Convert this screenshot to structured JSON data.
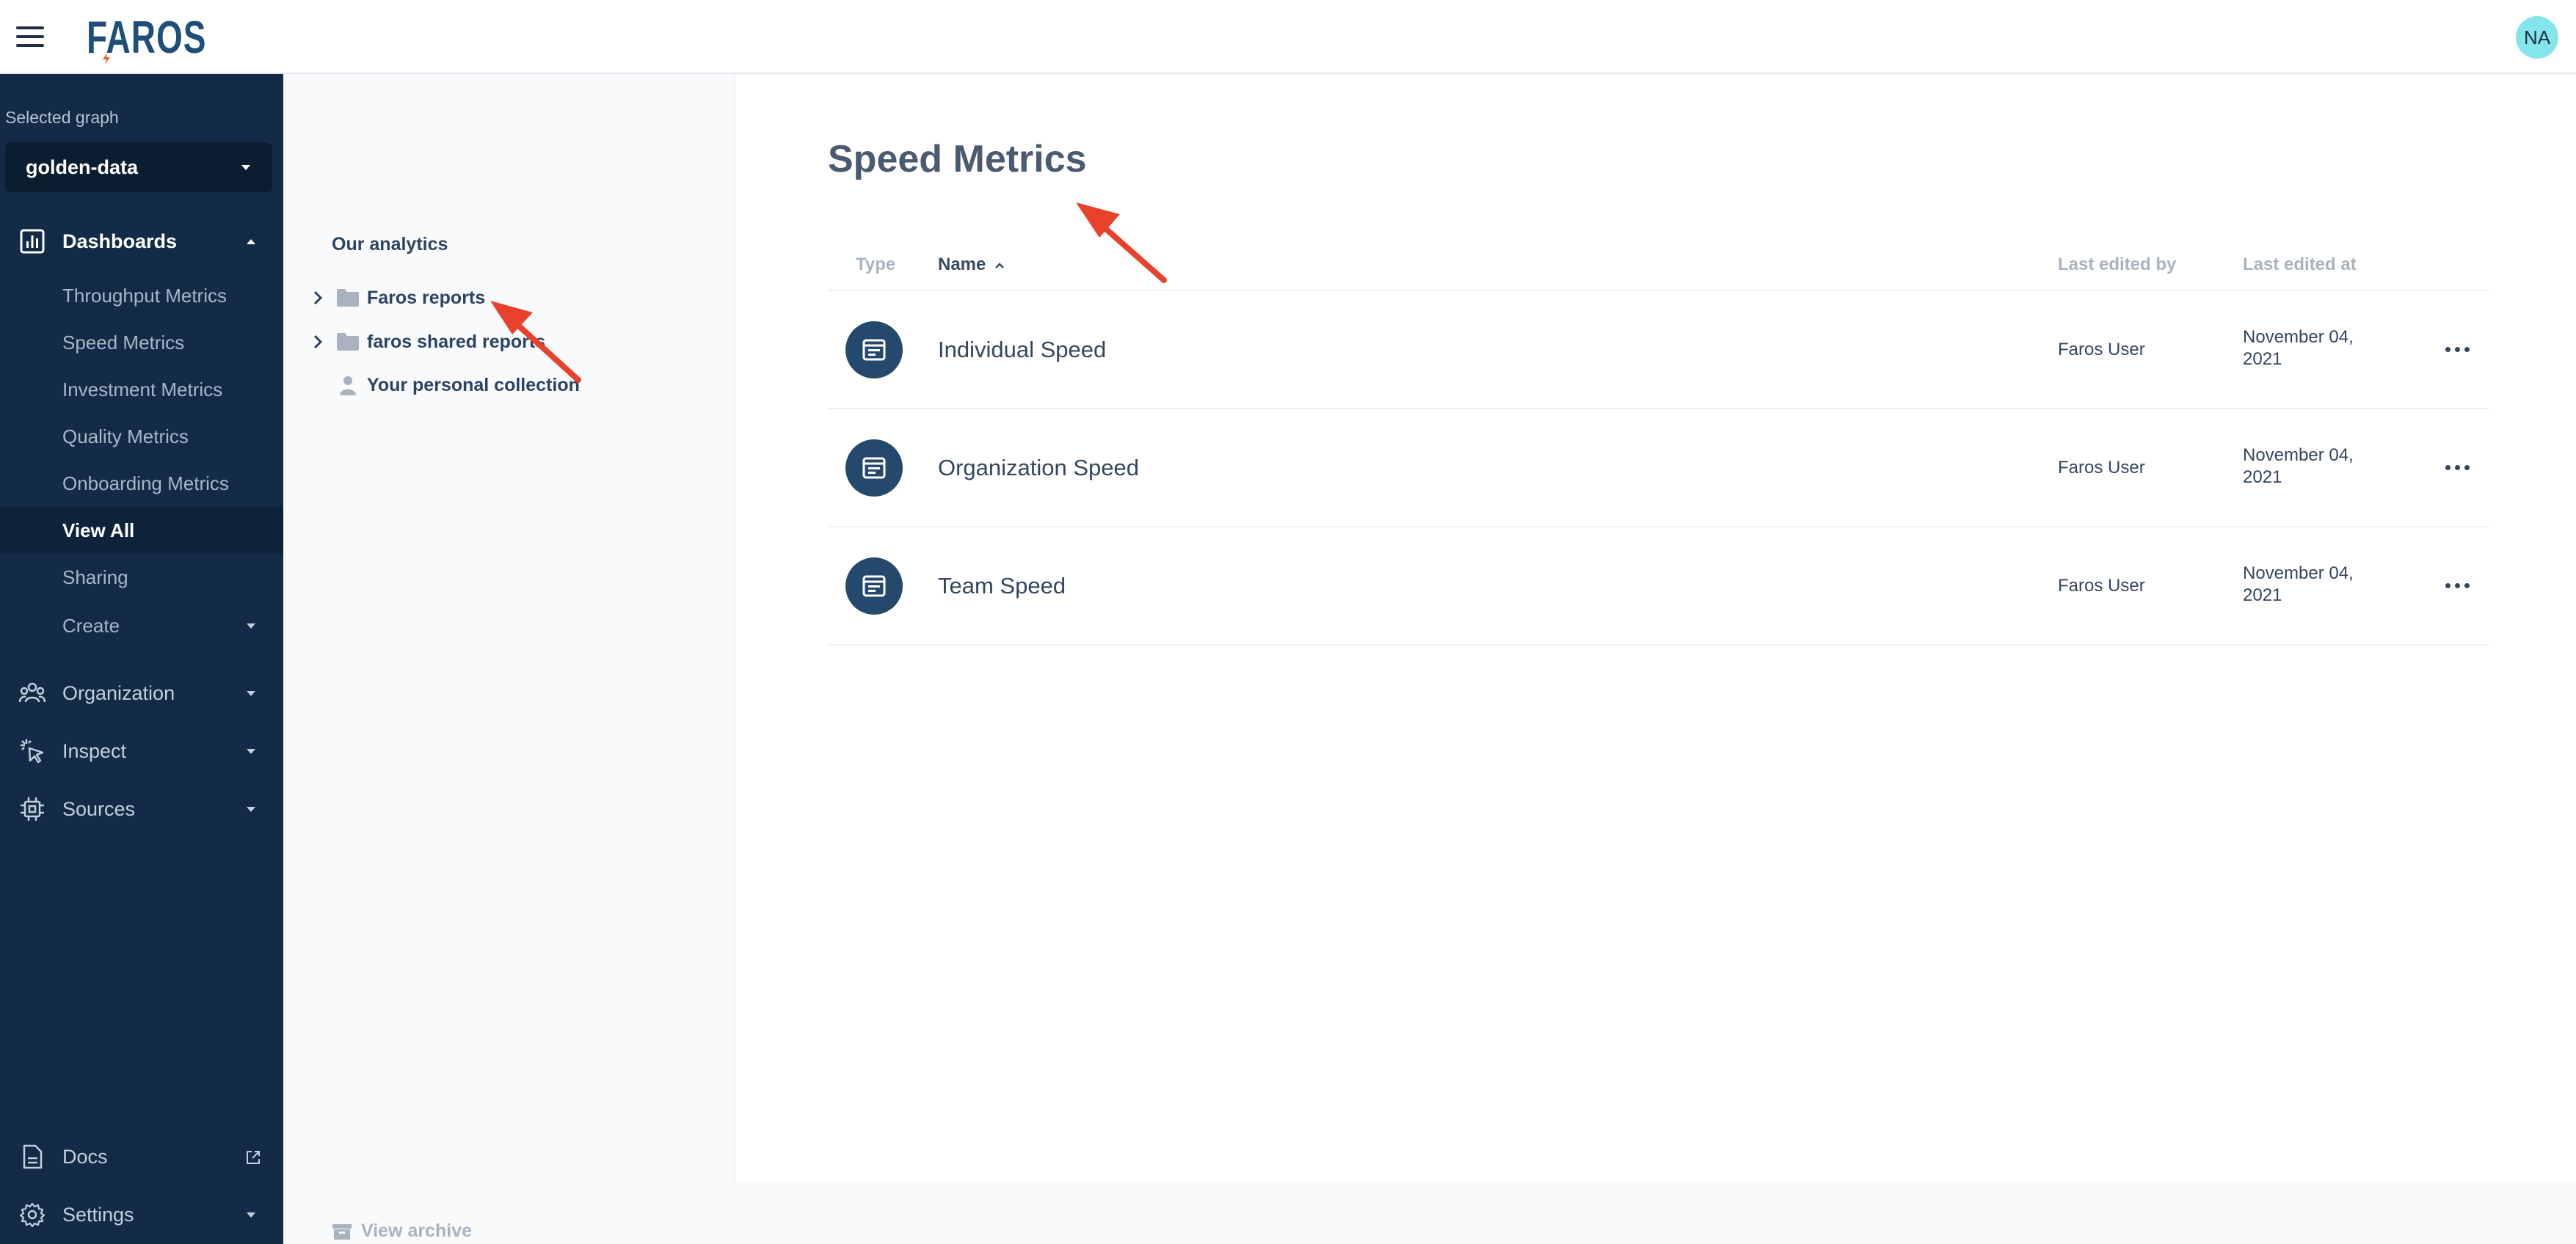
{
  "header": {
    "logo_text": "FAROS",
    "avatar_initials": "NA"
  },
  "sidebar": {
    "selected_graph_label": "Selected graph",
    "selected_graph_value": "golden-data",
    "dashboards": {
      "label": "Dashboards",
      "items": [
        {
          "label": "Throughput Metrics"
        },
        {
          "label": "Speed Metrics"
        },
        {
          "label": "Investment Metrics"
        },
        {
          "label": "Quality Metrics"
        },
        {
          "label": "Onboarding Metrics"
        },
        {
          "label": "View All"
        },
        {
          "label": "Sharing"
        },
        {
          "label": "Create"
        }
      ]
    },
    "sections": [
      {
        "label": "Organization",
        "icon": "organization-icon"
      },
      {
        "label": "Inspect",
        "icon": "inspect-icon"
      },
      {
        "label": "Sources",
        "icon": "sources-icon"
      }
    ],
    "bottom": [
      {
        "label": "Docs",
        "icon": "docs-icon"
      },
      {
        "label": "Settings",
        "icon": "settings-icon"
      }
    ]
  },
  "collections": {
    "title": "Our analytics",
    "items": [
      {
        "label": "Faros reports",
        "icon": "folder-icon"
      },
      {
        "label": "faros shared reports",
        "icon": "folder-icon"
      },
      {
        "label": "Your personal collection",
        "icon": "person-icon"
      }
    ],
    "archive_label": "View archive"
  },
  "main": {
    "title": "Speed Metrics",
    "columns": {
      "type": "Type",
      "name": "Name",
      "last_edited_by": "Last edited by",
      "last_edited_at": "Last edited at"
    },
    "rows": [
      {
        "name": "Individual Speed",
        "editor": "Faros User",
        "date": "November 04, 2021"
      },
      {
        "name": "Organization Speed",
        "editor": "Faros User",
        "date": "November 04, 2021"
      },
      {
        "name": "Team Speed",
        "editor": "Faros User",
        "date": "November 04, 2021"
      }
    ]
  },
  "colors": {
    "sidebar_bg": "#132b47",
    "accent_avatar": "#84e6ea",
    "annotation_arrow": "#e8412c"
  }
}
